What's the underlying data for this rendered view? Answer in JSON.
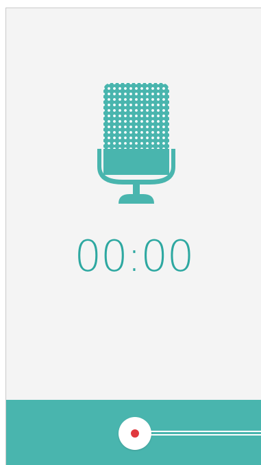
{
  "recorder": {
    "elapsed_time": "00:00",
    "mic_icon": "microphone-icon",
    "record_button_icon": "record-dot-icon"
  },
  "colors": {
    "accent": "#49b5ae",
    "timer_text": "#2ea8a1",
    "background": "#f4f4f4",
    "record_dot": "#e0393e"
  }
}
